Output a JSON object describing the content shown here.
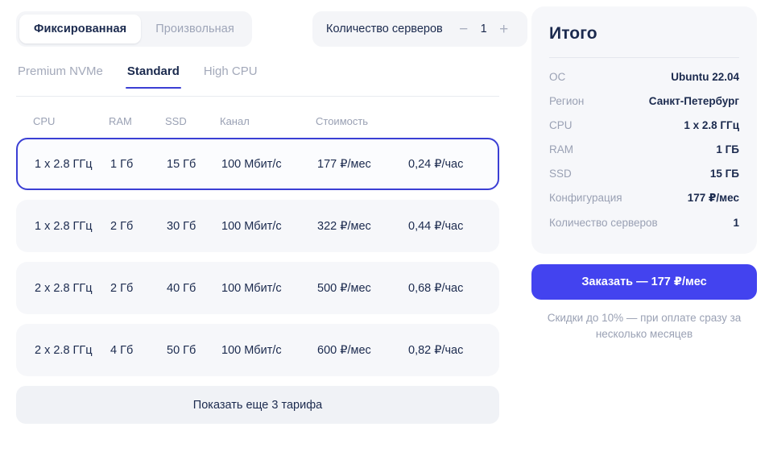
{
  "billing_toggle": {
    "options": [
      {
        "label": "Фиксированная",
        "active": true
      },
      {
        "label": "Произвольная",
        "active": false
      }
    ]
  },
  "server_count": {
    "label": "Количество серверов",
    "decrement_icon": "minus-icon",
    "decrement_glyph": "−",
    "value": "1",
    "increment_icon": "plus-icon",
    "increment_glyph": "+"
  },
  "plan_tabs": [
    {
      "label": "Premium NVMe",
      "active": false
    },
    {
      "label": "Standard",
      "active": true
    },
    {
      "label": "High CPU",
      "active": false
    }
  ],
  "table": {
    "headers": [
      "CPU",
      "RAM",
      "SSD",
      "Канал",
      "Стоимость",
      ""
    ],
    "rows": [
      {
        "selected": true,
        "cells": [
          "1 x 2.8 ГГц",
          "1 Гб",
          "15 Гб",
          "100 Мбит/с",
          "177 ₽/мес",
          "0,24 ₽/час"
        ]
      },
      {
        "selected": false,
        "cells": [
          "1 x 2.8 ГГц",
          "2 Гб",
          "30 Гб",
          "100 Мбит/с",
          "322 ₽/мес",
          "0,44 ₽/час"
        ]
      },
      {
        "selected": false,
        "cells": [
          "2 x 2.8 ГГц",
          "2 Гб",
          "40 Гб",
          "100 Мбит/с",
          "500 ₽/мес",
          "0,68 ₽/час"
        ]
      },
      {
        "selected": false,
        "cells": [
          "2 x 2.8 ГГц",
          "4 Гб",
          "50 Гб",
          "100 Мбит/с",
          "600 ₽/мес",
          "0,82 ₽/час"
        ]
      }
    ],
    "show_more_label": "Показать еще 3 тарифа"
  },
  "summary": {
    "title": "Итого",
    "rows": [
      {
        "key": "ОС",
        "value": "Ubuntu 22.04"
      },
      {
        "key": "Регион",
        "value": "Санкт-Петербург"
      },
      {
        "key": "CPU",
        "value": "1 x 2.8 ГГц"
      },
      {
        "key": "RAM",
        "value": "1 ГБ"
      },
      {
        "key": "SSD",
        "value": "15 ГБ"
      },
      {
        "key": "Конфигурация",
        "value": "177 ₽/мес"
      },
      {
        "key": "Количество серверов",
        "value": "1"
      }
    ],
    "order_button_label": "Заказать — 177 ₽/мес",
    "discount_note": "Скидки до 10% — при оплате сразу за несколько месяцев"
  },
  "colors": {
    "accent": "#4343ef",
    "accent_border": "#3b3fd4",
    "text": "#1b2a4e",
    "muted": "#9aa1b4",
    "row_bg": "#f6f7fa",
    "panel_bg": "#f6f7fa"
  }
}
